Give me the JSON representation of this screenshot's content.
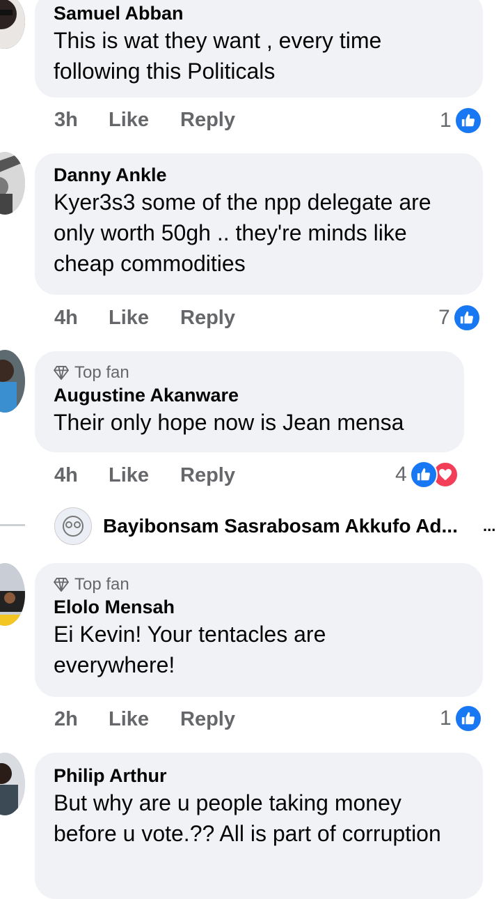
{
  "comments": [
    {
      "author": "Samuel Abban",
      "top_fan": false,
      "text": "This is wat they want , every time following this Politicals",
      "time": "3h",
      "like_label": "Like",
      "reply_label": "Reply",
      "reaction_count": "1",
      "reactions": [
        "like-icon"
      ]
    },
    {
      "author": "Danny Ankle",
      "top_fan": false,
      "text": "Kyer3s3 some of the npp delegate are only worth 50gh  .. they're minds like cheap commodities",
      "time": "4h",
      "like_label": "Like",
      "reply_label": "Reply",
      "reaction_count": "7",
      "reactions": [
        "like-icon"
      ]
    },
    {
      "author": "Augustine Akanware",
      "top_fan": true,
      "top_fan_label": "Top fan",
      "text": "Their only hope now is Jean mensa",
      "time": "4h",
      "like_label": "Like",
      "reply_label": "Reply",
      "reaction_count": "4",
      "reactions": [
        "like-icon",
        "love-icon"
      ]
    },
    {
      "author": "Elolo Mensah",
      "top_fan": true,
      "top_fan_label": "Top fan",
      "text": "Ei Kevin! Your tentacles are everywhere!",
      "time": "2h",
      "like_label": "Like",
      "reply_label": "Reply",
      "reaction_count": "1",
      "reactions": [
        "like-icon"
      ]
    },
    {
      "author": "Philip Arthur",
      "top_fan": false,
      "text": "But why are u people taking money before u vote.?? All is part of corruption"
    }
  ],
  "collapsed_reply": {
    "author": "Bayibonsam Sasrabosam Akkufo Ad...",
    "more": "..."
  },
  "colors": {
    "bubble": "#f0f2f5",
    "meta_text": "#65676b",
    "like_blue": "#1877f2",
    "love_red": "#f33e58"
  }
}
